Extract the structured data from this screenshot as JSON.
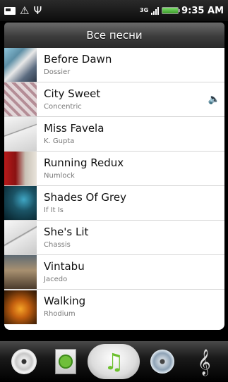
{
  "status_bar": {
    "network": "3G",
    "time": "9:35 AM"
  },
  "header": {
    "title": "Все песни"
  },
  "songs": [
    {
      "title": "Before Dawn",
      "artist": "Dossier"
    },
    {
      "title": "City Sweet",
      "artist": "Concentric",
      "now_playing": true
    },
    {
      "title": "Miss Favela",
      "artist": "K. Gupta"
    },
    {
      "title": "Running Redux",
      "artist": "Numlock"
    },
    {
      "title": "Shades Of Grey",
      "artist": "If It Is"
    },
    {
      "title": "She's Lit",
      "artist": "Chassis"
    },
    {
      "title": "Vintabu",
      "artist": "Jacedo"
    },
    {
      "title": "Walking",
      "artist": "Rhodium"
    }
  ],
  "bottom_tabs": [
    {
      "icon": "cd-icon",
      "active": false
    },
    {
      "icon": "now-playing-icon",
      "active": false
    },
    {
      "icon": "music-note-icon",
      "active": true
    },
    {
      "icon": "disc-icon",
      "active": false
    },
    {
      "icon": "treble-clef-icon",
      "active": false
    }
  ],
  "colors": {
    "accent": "#6cc02e",
    "list_bg": "#ffffff",
    "artist_text": "#777777"
  }
}
